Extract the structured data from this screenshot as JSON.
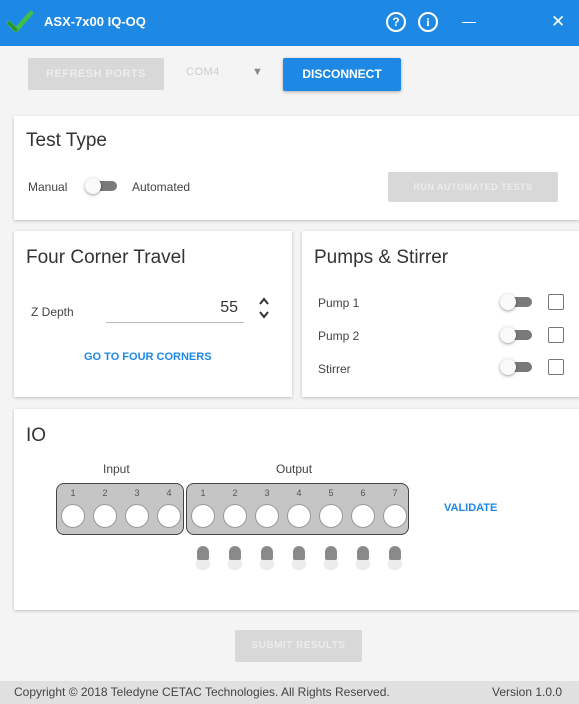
{
  "window": {
    "title": "ASX-7x00 IQ-OQ",
    "help_glyph": "?",
    "info_glyph": "i",
    "close_glyph": "✕",
    "accent_color": "#1e88e5",
    "logo_icon": "green-checkmark-icon"
  },
  "toolbar": {
    "refresh_label": "REFRESH PORTS",
    "com_port_value": "COM4",
    "disconnect_label": "DISCONNECT"
  },
  "test_type": {
    "title": "Test Type",
    "manual_label": "Manual",
    "automated_label": "Automated",
    "run_button_label": "RUN AUTOMATED TESTS",
    "automated_on": false
  },
  "four_corner": {
    "title": "Four Corner Travel",
    "z_depth_label": "Z Depth",
    "z_depth_value": "55",
    "go_button_label": "GO TO FOUR CORNERS"
  },
  "pumps": {
    "title": "Pumps & Stirrer",
    "items": [
      {
        "label": "Pump 1",
        "on": false,
        "checked": false
      },
      {
        "label": "Pump 2",
        "on": false,
        "checked": false
      },
      {
        "label": "Stirrer",
        "on": false,
        "checked": false
      }
    ]
  },
  "io": {
    "title": "IO",
    "input_label": "Input",
    "output_label": "Output",
    "inputs": [
      "1",
      "2",
      "3",
      "4"
    ],
    "outputs": [
      "1",
      "2",
      "3",
      "4",
      "5",
      "6",
      "7"
    ],
    "validate_label": "VALIDATE"
  },
  "bottom": {
    "submit_label": "SUBMIT RESULTS"
  },
  "footer": {
    "copyright": "Copyright © 2018 Teledyne CETAC Technologies. All Rights Reserved.",
    "version": "Version 1.0.0"
  }
}
